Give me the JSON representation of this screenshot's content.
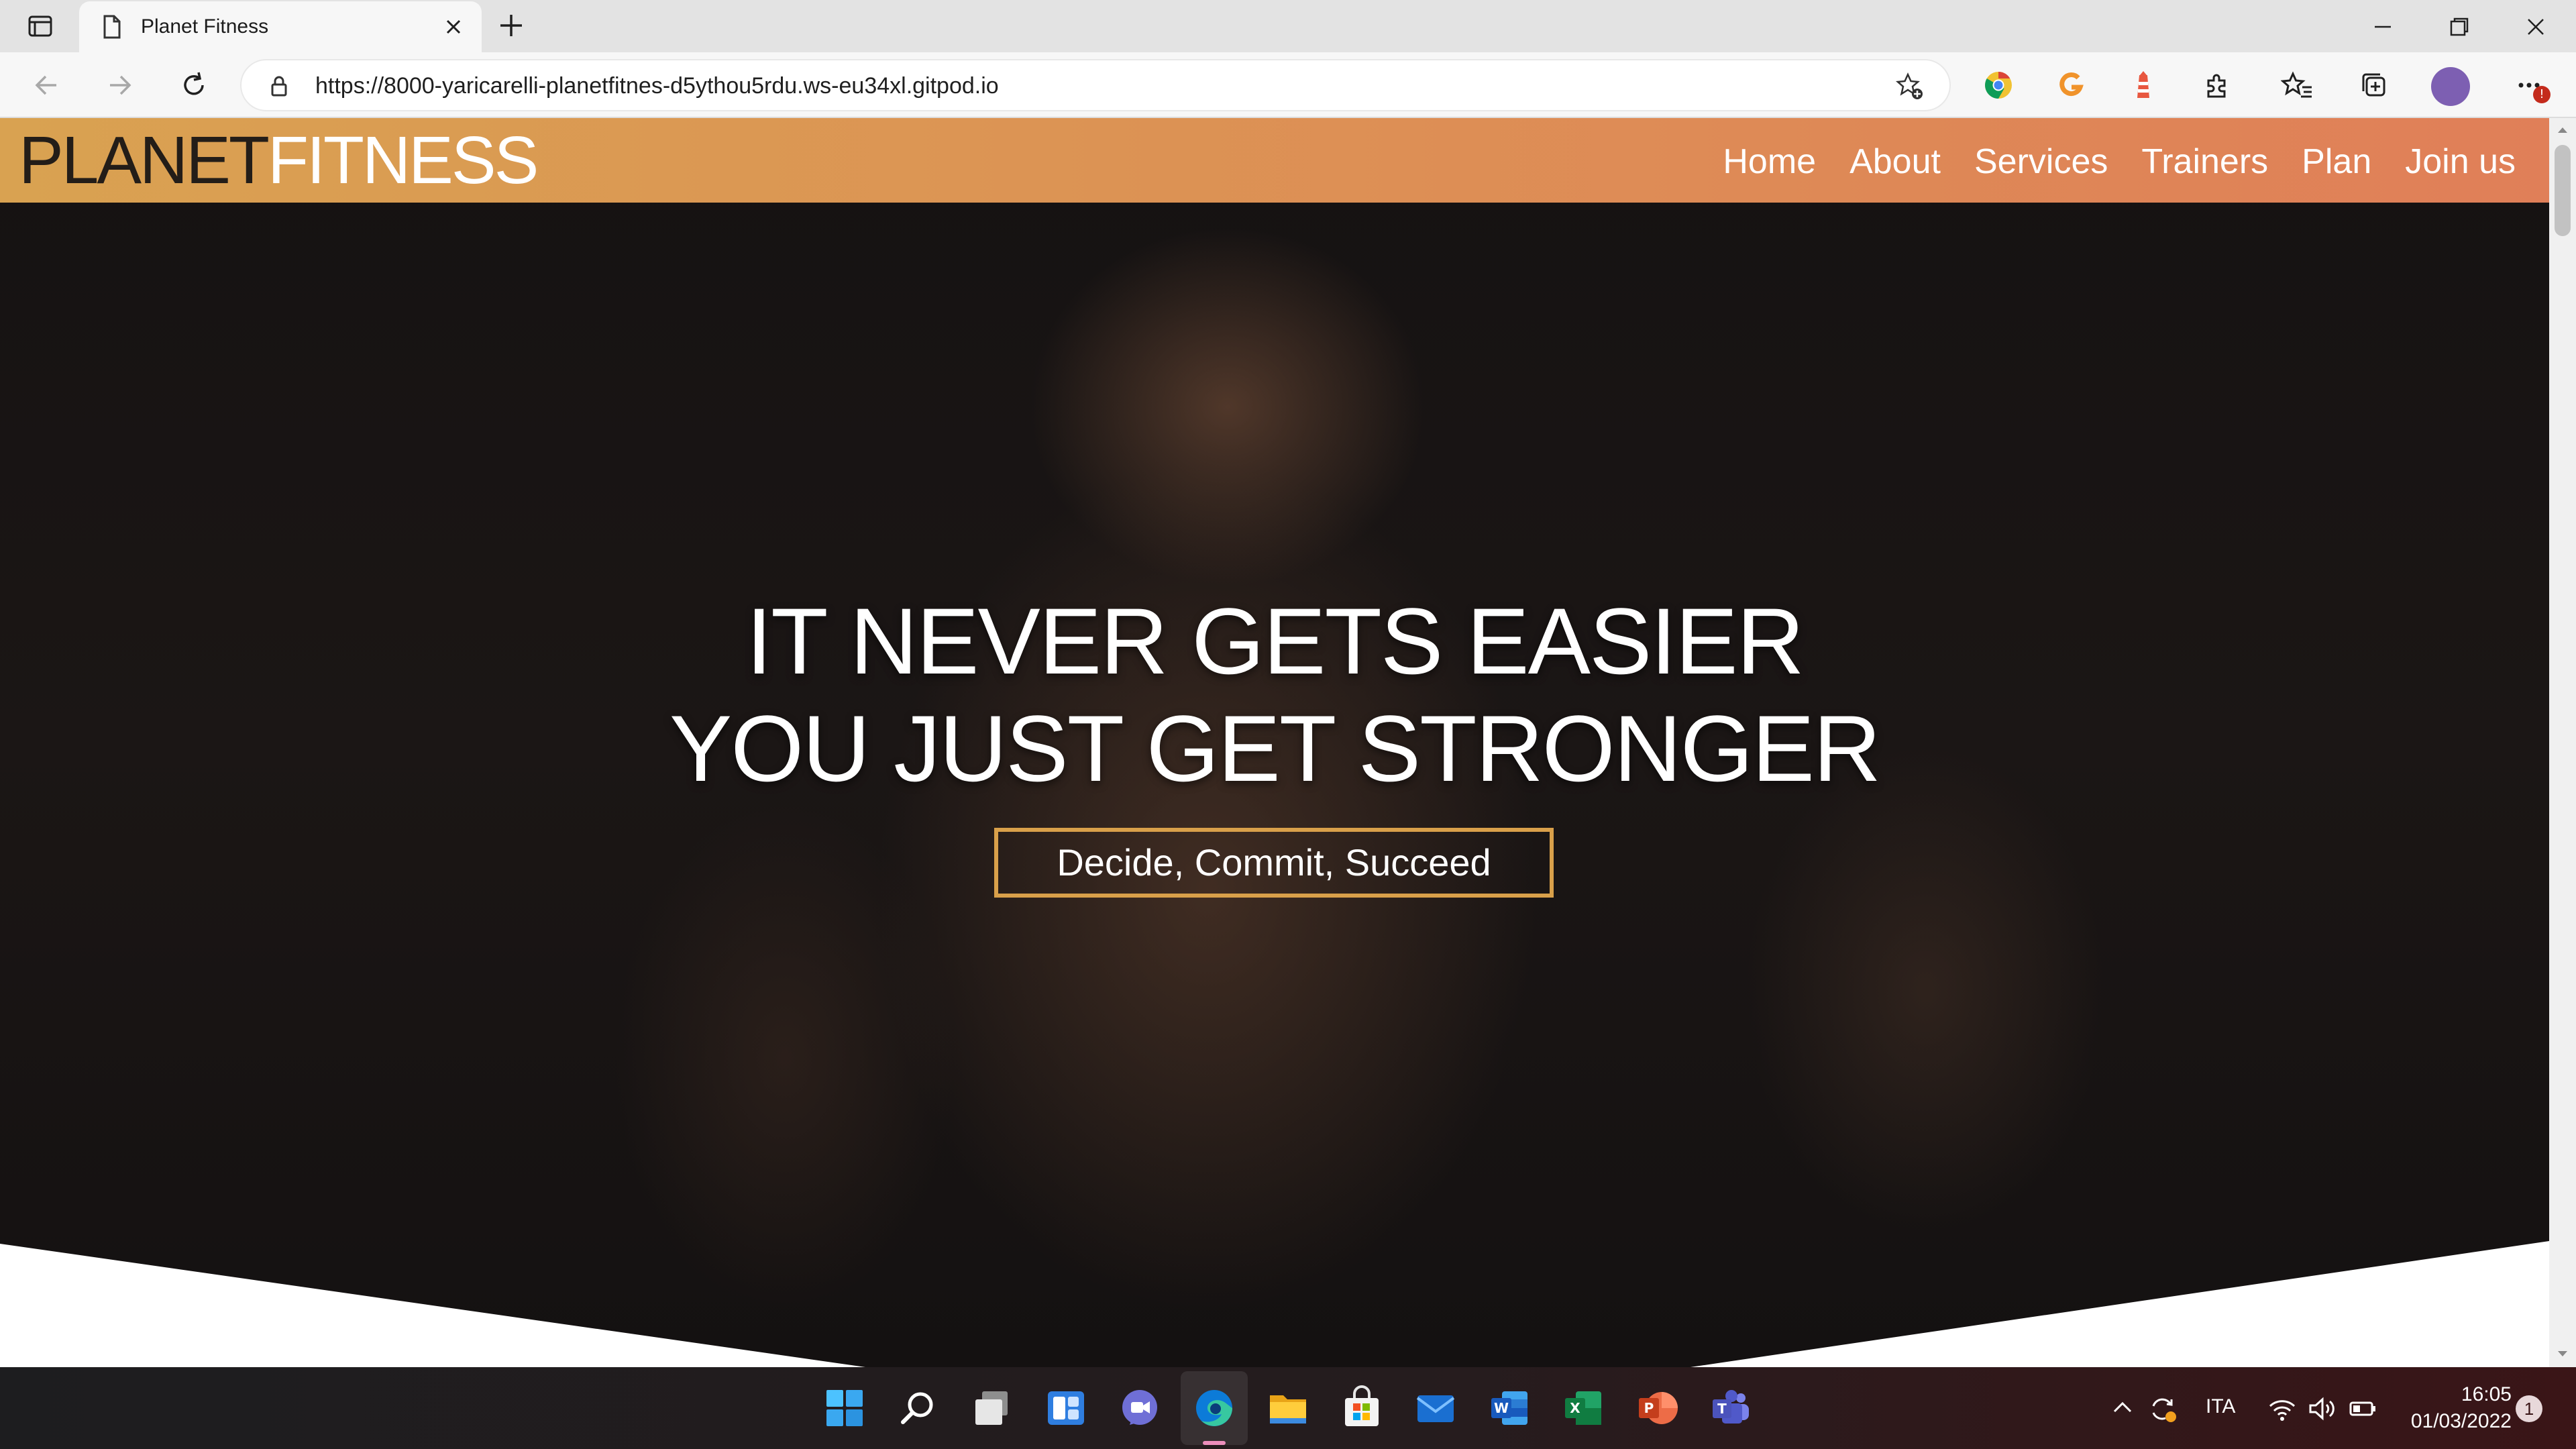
{
  "browser": {
    "tab": {
      "title": "Planet Fitness"
    },
    "url": "https://8000-yaricarelli-planetfitnes-d5ythou5rdu.ws-eu34xl.gitpod.io"
  },
  "site": {
    "logo": {
      "part1": "PLANET",
      "part2": "FITNESS"
    },
    "nav": [
      "Home",
      "About",
      "Services",
      "Trainers",
      "Plan",
      "Join us"
    ],
    "hero": {
      "line1": "IT NEVER GETS EASIER",
      "line2": "YOU JUST GET STRONGER",
      "cta": "Decide, Commit, Succeed"
    }
  },
  "taskbar": {
    "language": "ITA",
    "time": "16:05",
    "date": "01/03/2022",
    "notifications": "1"
  },
  "colors": {
    "nav_gradient_start": "#d9a251",
    "nav_gradient_end": "#e07f58",
    "cta_border": "#d9a04a",
    "logo_dark": "#231d18"
  }
}
